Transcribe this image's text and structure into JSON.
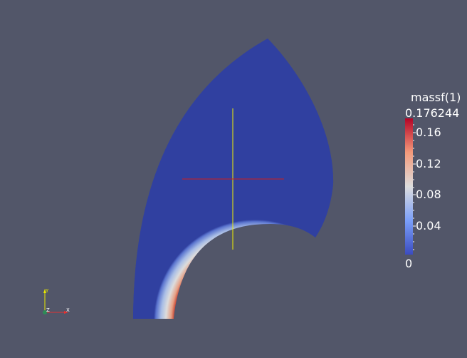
{
  "colorbar": {
    "title": "massf(1)",
    "max_label": "0.176244",
    "min_label": "0",
    "ticks": [
      "0.16",
      "0.12",
      "0.08",
      "0.04"
    ],
    "colors": {
      "low": "#3b4cc0",
      "mid": "#dddddd",
      "high": "#b40426"
    }
  },
  "orientation_axes": {
    "y_label": "Y",
    "z_label": "Z",
    "x_label": "X",
    "colors": {
      "x": "#e33232",
      "y": "#e8e800",
      "z": "#2e8b57"
    }
  },
  "crosshair": {
    "colors": {
      "vertical": "#f0f000",
      "horizontal": "#d01c1c"
    }
  },
  "scene": {
    "background": "#525669",
    "field_color": "#3040a0"
  }
}
